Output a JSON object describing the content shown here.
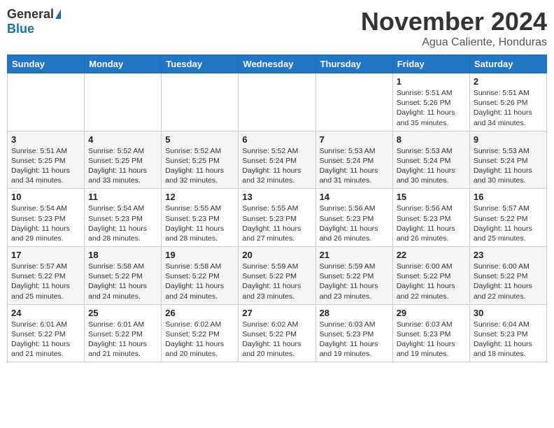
{
  "header": {
    "logo_general": "General",
    "logo_blue": "Blue",
    "month_title": "November 2024",
    "subtitle": "Agua Caliente, Honduras"
  },
  "calendar": {
    "days_of_week": [
      "Sunday",
      "Monday",
      "Tuesday",
      "Wednesday",
      "Thursday",
      "Friday",
      "Saturday"
    ],
    "weeks": [
      [
        {
          "day": "",
          "info": ""
        },
        {
          "day": "",
          "info": ""
        },
        {
          "day": "",
          "info": ""
        },
        {
          "day": "",
          "info": ""
        },
        {
          "day": "",
          "info": ""
        },
        {
          "day": "1",
          "info": "Sunrise: 5:51 AM\nSunset: 5:26 PM\nDaylight: 11 hours\nand 35 minutes."
        },
        {
          "day": "2",
          "info": "Sunrise: 5:51 AM\nSunset: 5:26 PM\nDaylight: 11 hours\nand 34 minutes."
        }
      ],
      [
        {
          "day": "3",
          "info": "Sunrise: 5:51 AM\nSunset: 5:25 PM\nDaylight: 11 hours\nand 34 minutes."
        },
        {
          "day": "4",
          "info": "Sunrise: 5:52 AM\nSunset: 5:25 PM\nDaylight: 11 hours\nand 33 minutes."
        },
        {
          "day": "5",
          "info": "Sunrise: 5:52 AM\nSunset: 5:25 PM\nDaylight: 11 hours\nand 32 minutes."
        },
        {
          "day": "6",
          "info": "Sunrise: 5:52 AM\nSunset: 5:24 PM\nDaylight: 11 hours\nand 32 minutes."
        },
        {
          "day": "7",
          "info": "Sunrise: 5:53 AM\nSunset: 5:24 PM\nDaylight: 11 hours\nand 31 minutes."
        },
        {
          "day": "8",
          "info": "Sunrise: 5:53 AM\nSunset: 5:24 PM\nDaylight: 11 hours\nand 30 minutes."
        },
        {
          "day": "9",
          "info": "Sunrise: 5:53 AM\nSunset: 5:24 PM\nDaylight: 11 hours\nand 30 minutes."
        }
      ],
      [
        {
          "day": "10",
          "info": "Sunrise: 5:54 AM\nSunset: 5:23 PM\nDaylight: 11 hours\nand 29 minutes."
        },
        {
          "day": "11",
          "info": "Sunrise: 5:54 AM\nSunset: 5:23 PM\nDaylight: 11 hours\nand 28 minutes."
        },
        {
          "day": "12",
          "info": "Sunrise: 5:55 AM\nSunset: 5:23 PM\nDaylight: 11 hours\nand 28 minutes."
        },
        {
          "day": "13",
          "info": "Sunrise: 5:55 AM\nSunset: 5:23 PM\nDaylight: 11 hours\nand 27 minutes."
        },
        {
          "day": "14",
          "info": "Sunrise: 5:56 AM\nSunset: 5:23 PM\nDaylight: 11 hours\nand 26 minutes."
        },
        {
          "day": "15",
          "info": "Sunrise: 5:56 AM\nSunset: 5:23 PM\nDaylight: 11 hours\nand 26 minutes."
        },
        {
          "day": "16",
          "info": "Sunrise: 5:57 AM\nSunset: 5:22 PM\nDaylight: 11 hours\nand 25 minutes."
        }
      ],
      [
        {
          "day": "17",
          "info": "Sunrise: 5:57 AM\nSunset: 5:22 PM\nDaylight: 11 hours\nand 25 minutes."
        },
        {
          "day": "18",
          "info": "Sunrise: 5:58 AM\nSunset: 5:22 PM\nDaylight: 11 hours\nand 24 minutes."
        },
        {
          "day": "19",
          "info": "Sunrise: 5:58 AM\nSunset: 5:22 PM\nDaylight: 11 hours\nand 24 minutes."
        },
        {
          "day": "20",
          "info": "Sunrise: 5:59 AM\nSunset: 5:22 PM\nDaylight: 11 hours\nand 23 minutes."
        },
        {
          "day": "21",
          "info": "Sunrise: 5:59 AM\nSunset: 5:22 PM\nDaylight: 11 hours\nand 23 minutes."
        },
        {
          "day": "22",
          "info": "Sunrise: 6:00 AM\nSunset: 5:22 PM\nDaylight: 11 hours\nand 22 minutes."
        },
        {
          "day": "23",
          "info": "Sunrise: 6:00 AM\nSunset: 5:22 PM\nDaylight: 11 hours\nand 22 minutes."
        }
      ],
      [
        {
          "day": "24",
          "info": "Sunrise: 6:01 AM\nSunset: 5:22 PM\nDaylight: 11 hours\nand 21 minutes."
        },
        {
          "day": "25",
          "info": "Sunrise: 6:01 AM\nSunset: 5:22 PM\nDaylight: 11 hours\nand 21 minutes."
        },
        {
          "day": "26",
          "info": "Sunrise: 6:02 AM\nSunset: 5:22 PM\nDaylight: 11 hours\nand 20 minutes."
        },
        {
          "day": "27",
          "info": "Sunrise: 6:02 AM\nSunset: 5:22 PM\nDaylight: 11 hours\nand 20 minutes."
        },
        {
          "day": "28",
          "info": "Sunrise: 6:03 AM\nSunset: 5:23 PM\nDaylight: 11 hours\nand 19 minutes."
        },
        {
          "day": "29",
          "info": "Sunrise: 6:03 AM\nSunset: 5:23 PM\nDaylight: 11 hours\nand 19 minutes."
        },
        {
          "day": "30",
          "info": "Sunrise: 6:04 AM\nSunset: 5:23 PM\nDaylight: 11 hours\nand 18 minutes."
        }
      ]
    ]
  }
}
